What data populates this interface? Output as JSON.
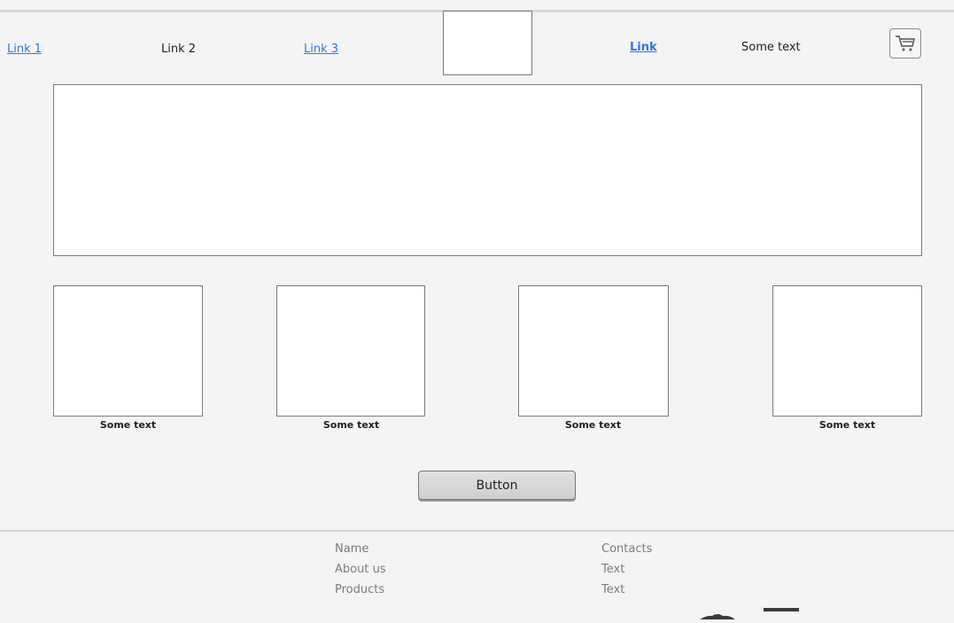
{
  "nav": {
    "link1": "Link 1",
    "link2": "Link 2",
    "link3": "Link 3",
    "link4": "Link",
    "text": "Some text"
  },
  "thumbnails": [
    {
      "caption": "Some text"
    },
    {
      "caption": "Some text"
    },
    {
      "caption": "Some text"
    },
    {
      "caption": "Some text"
    }
  ],
  "button": {
    "label": "Button"
  },
  "footer": {
    "col1": [
      "Name",
      "About us",
      "Products"
    ],
    "col2": [
      "Contacts",
      "Text",
      "Text"
    ]
  },
  "icons": {
    "cart": "shopping-cart-icon"
  },
  "colors": {
    "link": "#2f7ad8",
    "background": "#f4f4f4",
    "footer_text": "#7b7b7b"
  }
}
